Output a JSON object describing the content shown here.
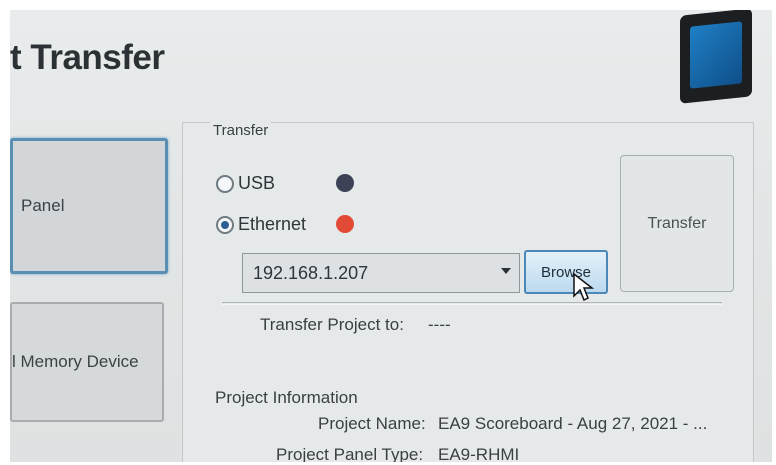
{
  "window": {
    "title": "t Transfer"
  },
  "side": {
    "panel_label": "Panel",
    "memory_label": "l Memory Device"
  },
  "transfer": {
    "group_label": "Transfer",
    "usb_label": "USB",
    "ethernet_label": "Ethernet",
    "ip_value": "192.168.1.207",
    "browse_label": "Browse",
    "transfer_button_label": "Transfer",
    "project_to_label": "Transfer Project to:",
    "project_to_value": "----"
  },
  "project_info": {
    "header": "Project Information",
    "name_label": "Project Name:",
    "name_value": "EA9 Scoreboard - Aug 27, 2021 - ...",
    "panel_type_label": "Project Panel Type:",
    "panel_type_value": "EA9-RHMI"
  },
  "colors": {
    "usb_dot": "#3d4257",
    "ethernet_dot": "#e24a36",
    "accent": "#5a8fb5"
  },
  "icons": {
    "device": "panel-device-icon",
    "pointer": "mouse-pointer-icon"
  }
}
